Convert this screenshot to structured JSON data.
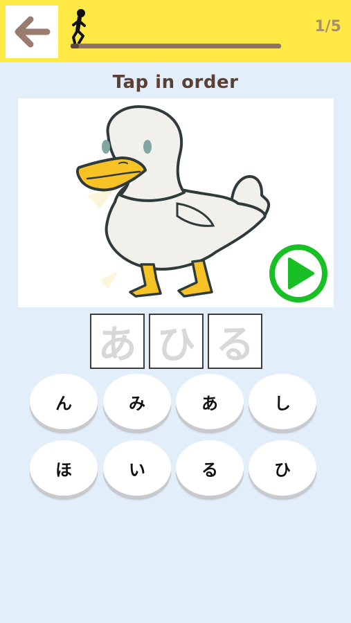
{
  "header": {
    "counter": "1/5",
    "progress_fraction": 0.04,
    "back_icon": "arrow-left-icon",
    "runner_icon": "running-figure-icon"
  },
  "instruction": "Tap in order",
  "picture": {
    "subject_icon": "duck-illustration",
    "play_icon": "play-icon"
  },
  "answer_slots": [
    "あ",
    "ひ",
    "る"
  ],
  "keys": [
    "ん",
    "み",
    "あ",
    "し",
    "ほ",
    "い",
    "る",
    "ひ"
  ],
  "colors": {
    "header_bg": "#ffea45",
    "page_bg": "#e2effb",
    "back_arrow": "#9a7c6e",
    "play_green": "#19c025",
    "title_brown": "#5b3e34"
  }
}
